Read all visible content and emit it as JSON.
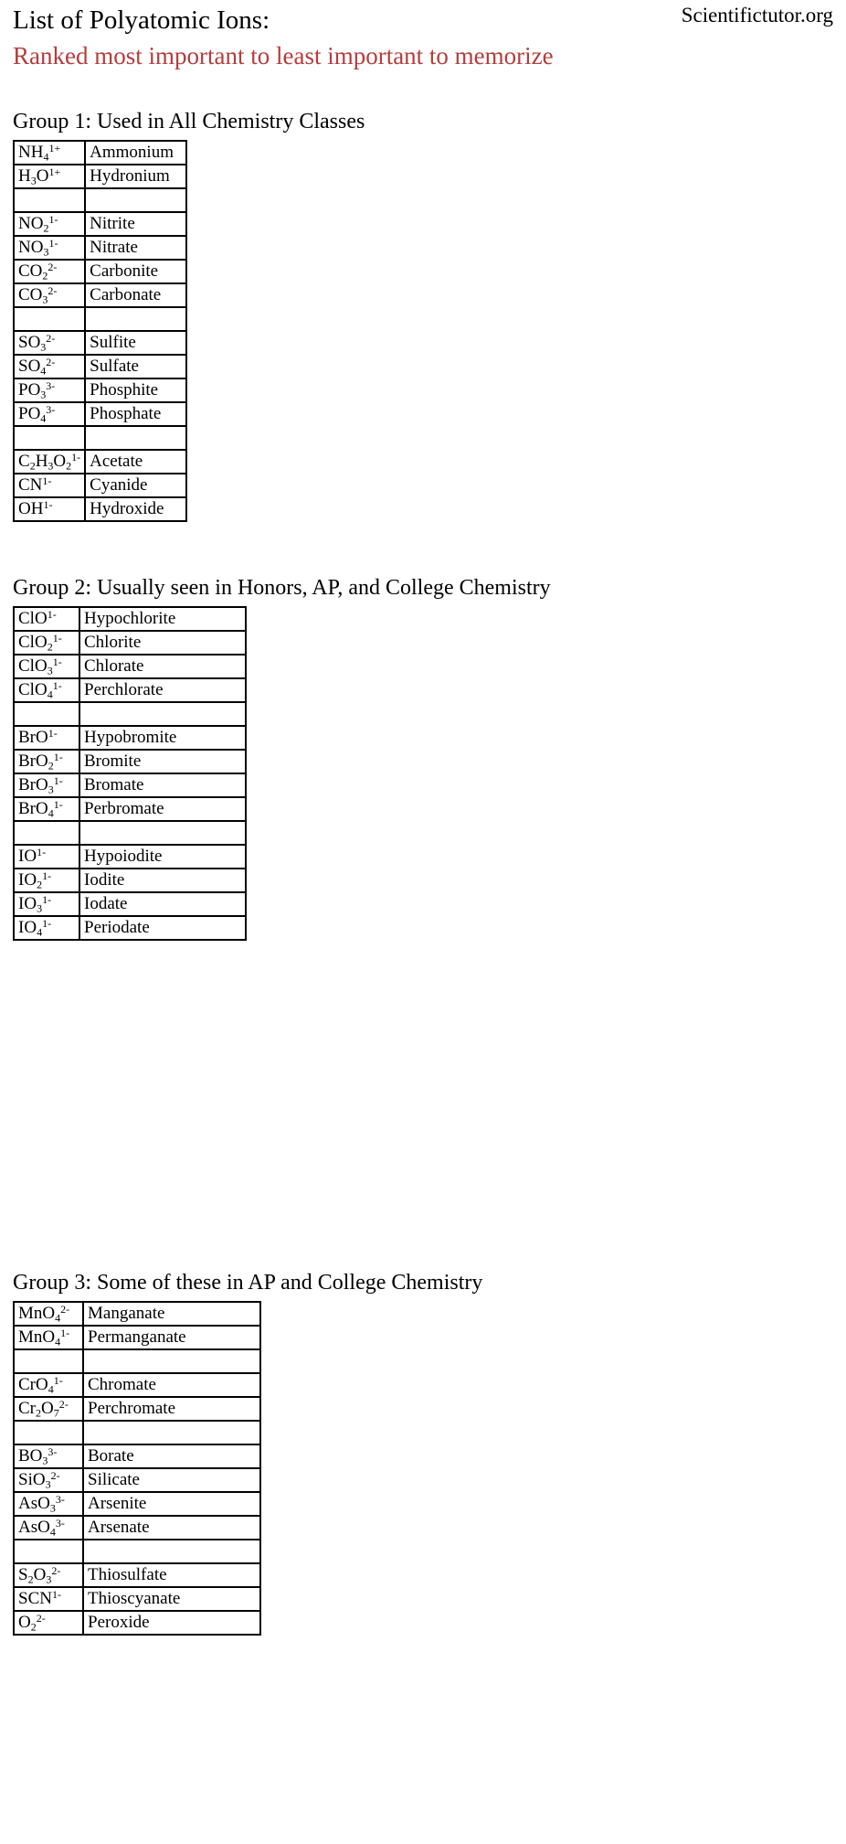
{
  "document": {
    "title": "List of Polyatomic Ions:",
    "subtitle": "Ranked most important to least important to memorize",
    "subtitle_color": "#b53c3c",
    "credit": "Scientifictutor.org"
  },
  "groups": [
    {
      "id": "group-1",
      "heading": "Group 1:  Used in All Chemistry Classes",
      "rows": [
        {
          "formula": "NH4(1+)",
          "element": "NH",
          "sub": "4",
          "sup": "1+",
          "name": "Ammonium"
        },
        {
          "formula": "H3O(1+)",
          "element": "H",
          "sub": "3",
          "sup": "1+",
          "tail": "O",
          "name": "Hydronium"
        },
        {
          "spacer": true,
          "formula": "",
          "name": ""
        },
        {
          "formula": "NO2(1-)",
          "element": "NO",
          "sub": "2",
          "sup": "1-",
          "name": "Nitrite"
        },
        {
          "formula": "NO3(1-)",
          "element": "NO",
          "sub": "3",
          "sup": "1-",
          "name": "Nitrate"
        },
        {
          "formula": "CO2(2-)",
          "element": "CO",
          "sub": "2",
          "sup": "2-",
          "name": "Carbonite"
        },
        {
          "formula": "CO3(2-)",
          "element": "CO",
          "sub": "3",
          "sup": "2-",
          "name": "Carbonate"
        },
        {
          "spacer": true,
          "formula": "",
          "name": ""
        },
        {
          "formula": "SO3(2-)",
          "element": "SO",
          "sub": "3",
          "sup": "2-",
          "name": "Sulfite"
        },
        {
          "formula": "SO4(2-)",
          "element": "SO",
          "sub": "4",
          "sup": "2-",
          "name": "Sulfate"
        },
        {
          "formula": "PO3(3-)",
          "element": "PO",
          "sub": "3",
          "sup": "3-",
          "name": "Phosphite"
        },
        {
          "formula": "PO4(3-)",
          "element": "PO",
          "sub": "4",
          "sup": "3-",
          "name": "Phosphate"
        },
        {
          "spacer": true,
          "formula": "",
          "name": ""
        },
        {
          "formula": "C2H3O2(1-)",
          "element": "C",
          "sub": "2",
          "sup": "1-",
          "name": "Acetate"
        },
        {
          "formula": "CN(1-)",
          "element": "CN",
          "sub": "",
          "sup": "1-",
          "name": "Cyanide"
        },
        {
          "formula": "OH(1-)",
          "element": "OH",
          "sub": "",
          "sup": "1-",
          "name": "Hydroxide"
        }
      ]
    },
    {
      "id": "group-2",
      "heading": "Group 2:  Usually seen in Honors, AP, and College Chemistry",
      "rows": [
        {
          "formula": "ClO(1-)",
          "element": "ClO",
          "sub": "",
          "sup": "1-",
          "name": "Hypochlorite"
        },
        {
          "formula": "ClO2(1-)",
          "element": "ClO",
          "sub": "2",
          "sup": "1-",
          "name": "Chlorite"
        },
        {
          "formula": "ClO3(1-)",
          "element": "ClO",
          "sub": "3",
          "sup": "1-",
          "name": "Chlorate"
        },
        {
          "formula": "ClO4(1-)",
          "element": "ClO",
          "sub": "4",
          "sup": "1-",
          "name": "Perchlorate"
        },
        {
          "spacer": true,
          "formula": "",
          "name": ""
        },
        {
          "formula": "BrO(1-)",
          "element": "BrO",
          "sub": "",
          "sup": "1-",
          "name": "Hypobromite"
        },
        {
          "formula": "BrO2(1-)",
          "element": "BrO",
          "sub": "2",
          "sup": "1-",
          "name": "Bromite"
        },
        {
          "formula": "BrO3(1-)",
          "element": "BrO",
          "sub": "3",
          "sup": "1-",
          "name": "Bromate"
        },
        {
          "formula": "BrO4(1-)",
          "element": "BrO",
          "sub": "4",
          "sup": "1-",
          "name": "Perbromate"
        },
        {
          "spacer": true,
          "formula": "",
          "name": ""
        },
        {
          "formula": "IO(1-)",
          "element": "IO",
          "sub": "",
          "sup": "1-",
          "name": "Hypoiodite"
        },
        {
          "formula": "IO2(1-)",
          "element": "IO",
          "sub": "2",
          "sup": "1-",
          "name": "Iodite"
        },
        {
          "formula": "IO3(1-)",
          "element": "IO",
          "sub": "3",
          "sup": "1-",
          "name": "Iodate"
        },
        {
          "formula": "IO4(1-)",
          "element": "IO",
          "sub": "4",
          "sup": "1-",
          "name": "Periodate"
        }
      ]
    },
    {
      "id": "group-3",
      "heading": "Group 3:  Some of these in AP and College Chemistry",
      "rows": [
        {
          "formula": "MnO4(2-)",
          "element": "MnO",
          "sub": "4",
          "sup": "2-",
          "name": "Manganate"
        },
        {
          "formula": "MnO4(1-)",
          "element": "MnO",
          "sub": "4",
          "sup": "1-",
          "name": "Permanganate"
        },
        {
          "spacer": true,
          "formula": "",
          "name": ""
        },
        {
          "formula": "CrO4(1-)",
          "element": "CrO",
          "sub": "4",
          "sup": "1-",
          "name": "Chromate"
        },
        {
          "formula": "Cr2O7(2-)",
          "element": "Cr",
          "sub": "2",
          "sup": "2-",
          "name": "Perchromate"
        },
        {
          "spacer": true,
          "formula": "",
          "name": ""
        },
        {
          "formula": "BO3(3-)",
          "element": "BO",
          "sub": "3",
          "sup": "3-",
          "name": "Borate"
        },
        {
          "formula": "SiO3(2-)",
          "element": "SiO",
          "sub": "3",
          "sup": "2-",
          "name": "Silicate"
        },
        {
          "formula": "AsO3(3-)",
          "element": "AsO",
          "sub": "3",
          "sup": "3-",
          "name": "Arsenite"
        },
        {
          "formula": "AsO4(3-)",
          "element": "AsO",
          "sub": "4",
          "sup": "3-",
          "name": "Arsenate"
        },
        {
          "spacer": true,
          "formula": "",
          "name": ""
        },
        {
          "formula": "S2O3(2-)",
          "element": "S",
          "sub": "2",
          "sup": "2-",
          "name": "Thiosulfate"
        },
        {
          "formula": "SCN(1-)",
          "element": "SCN",
          "sub": "",
          "sup": "1-",
          "name": "Thioscyanate"
        },
        {
          "formula": "O2(2-)",
          "element": "O",
          "sub": "2",
          "sup": "2-",
          "name": "Peroxide"
        }
      ]
    }
  ]
}
